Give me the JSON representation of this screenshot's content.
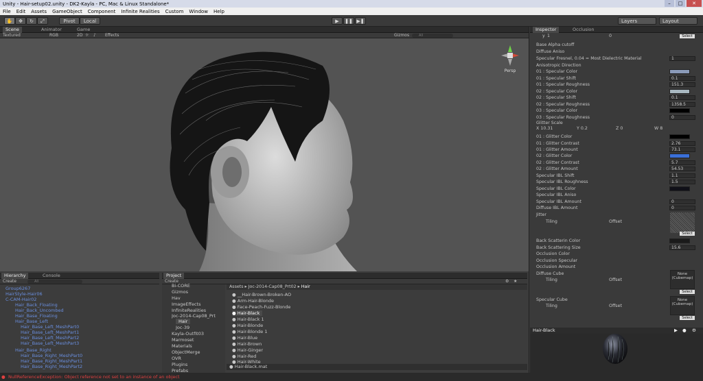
{
  "window": {
    "title": "Unity - Hair-setup02.unity - DK2-Kayla - PC, Mac & Linux Standalone*"
  },
  "menu": [
    "File",
    "Edit",
    "Assets",
    "GameObject",
    "Component",
    "Infinite Realities",
    "Custom",
    "Window",
    "Help"
  ],
  "toolbar": {
    "pivot": "Pivot",
    "local": "Local",
    "play": "▶",
    "pause": "❚❚",
    "step": "▶❚",
    "layers": "Layers",
    "layout": "Layout"
  },
  "scene": {
    "tabs": [
      "Scene",
      "Animator",
      "Game"
    ],
    "shading": "Textured",
    "rgb": "RGB",
    "mode2d": "2D",
    "effects": "Effects",
    "gizmos": "Gizmos",
    "search_placeholder": "All",
    "persp": "Persp"
  },
  "hierarchy": {
    "tab": "Hierarchy",
    "create": "Create",
    "search_placeholder": "All",
    "items": [
      "Group6267",
      "HairStyle-Hair06",
      "C-CAM-Hair02",
      "Hair_Back_Floating",
      "Hair_Back_Uncombed",
      "Hair_Base_Floating",
      "Hair_Base_Left",
      "Hair_Base_Left_MeshPart0",
      "Hair_Base_Left_MeshPart1",
      "Hair_Base_Left_MeshPart2",
      "Hair_Base_Left_MeshPart3",
      "Hair_Base_Right",
      "Hair_Base_Right_MeshPart0",
      "Hair_Base_Right_MeshPart1",
      "Hair_Base_Right_MeshPart2"
    ]
  },
  "console": {
    "tab": "Console"
  },
  "project": {
    "tab": "Project",
    "create": "Create",
    "folders": [
      "Bi-CORE",
      "Gizmos",
      "Hav",
      "ImageEffects",
      "InfiniteRealities",
      "Joc-2014-Cap08_Prt",
      "Hair",
      "Joc-39",
      "Kayla-Outfit03",
      "Marmoset",
      "Materials",
      "ObjectMerge",
      "OVR",
      "Plugins",
      "Prefabs"
    ],
    "breadcrumb": [
      "Assets",
      "Joc-2014-Cap08_Prt02",
      "Hair"
    ],
    "assets": [
      "__Hair-Brown-Broken-AO",
      "Arm-Hair-Blonde",
      "Face-Peach-Fuzz-Blonde",
      "Hair-Black",
      "Hair-Black 1",
      "Hair-Blonde",
      "Hair-Blonde 1",
      "Hair-Blue",
      "Hair-Brown",
      "Hair-Ginger",
      "Hair-Red",
      "Hair-White"
    ],
    "footer": "Hair-Black.mat"
  },
  "inspector": {
    "tabs": [
      "Inspector",
      "Occlusion"
    ],
    "top_row": {
      "label": "y",
      "value": "1",
      "value2": "0"
    },
    "rows": [
      {
        "label": "Base Alpha cutoff",
        "value": ""
      },
      {
        "label": "Diffuse Aniso",
        "value": ""
      },
      {
        "label": "Specular Fresnel, 0.04 = Most Dielectric Material",
        "value": "1"
      },
      {
        "label": "Anisotropic Direction",
        "value": ""
      },
      {
        "label": "01 : Specular Color",
        "swatch": "#8a9ab8"
      },
      {
        "label": "01 : Specular Shift",
        "value": "0.1"
      },
      {
        "label": "01 : Specular Roughness",
        "value": "151.3"
      },
      {
        "label": "02 : Specular Color",
        "swatch": "#a8b8c0"
      },
      {
        "label": "02 : Specular Shift",
        "value": "0.1"
      },
      {
        "label": "02 : Specular Roughness",
        "value": "1358.5"
      },
      {
        "label": "03 : Specular Color",
        "swatch": "#000000"
      },
      {
        "label": "03 : Specular Roughness",
        "value": "0"
      },
      {
        "label": "Glitter Scale",
        "value": ""
      },
      {
        "label": "01 : Glitter Color",
        "swatch": "#000000"
      },
      {
        "label": "01 : Glitter Contrast",
        "value": "2.76"
      },
      {
        "label": "01 : Glitter Amount",
        "value": "73.1"
      },
      {
        "label": "02 : Glitter Color",
        "swatch": "#3a6fd8"
      },
      {
        "label": "02 : Glitter Contrast",
        "value": "5.7"
      },
      {
        "label": "02 : Glitter Amount",
        "value": "54.53"
      },
      {
        "label": "Specular IBL Shift",
        "value": "1.1"
      },
      {
        "label": "Specular IBL Roughness",
        "value": "1.5"
      },
      {
        "label": "Specular IBL Color",
        "swatch": "#101018"
      },
      {
        "label": "Specular IBL Aniso",
        "value": ""
      },
      {
        "label": "Specular IBL Amount",
        "value": "0"
      },
      {
        "label": "Diffuse IBL Amount",
        "value": "0"
      },
      {
        "label": "Jitter",
        "value": ""
      }
    ],
    "glitter_scale": {
      "x": "10.31",
      "y": "0.2",
      "z": "0",
      "w": "8"
    },
    "tiling": "Tiling",
    "offset": "Offset",
    "rows2": [
      {
        "label": "Back Scatterin Color",
        "swatch": "#1a1a1a"
      },
      {
        "label": "Back Scattering Size",
        "value": "15.6"
      },
      {
        "label": "Occlusion Color",
        "value": ""
      },
      {
        "label": "Occlusion Specular",
        "value": ""
      },
      {
        "label": "Occlusion Amount",
        "value": ""
      },
      {
        "label": "Diffuse Cube",
        "value": ""
      },
      {
        "label": "Specular Cube",
        "value": ""
      }
    ],
    "cubemap_none": "None (Cubemap)",
    "select": "Select",
    "preview_title": "Hair-Black"
  },
  "status": {
    "text": "NullReferenceException: Object reference not set to an instance of an object"
  }
}
